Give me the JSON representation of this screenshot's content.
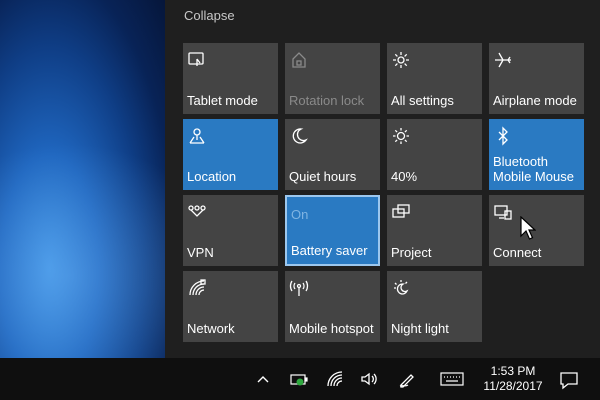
{
  "action_center": {
    "collapse_label": "Collapse",
    "tiles": [
      {
        "label": "Tablet mode",
        "icon": "tablet-mode-icon",
        "state": "off"
      },
      {
        "label": "Rotation lock",
        "icon": "rotation-lock-icon",
        "state": "disabled"
      },
      {
        "label": "All settings",
        "icon": "gear-icon",
        "state": "off"
      },
      {
        "label": "Airplane mode",
        "icon": "airplane-icon",
        "state": "off"
      },
      {
        "label": "Location",
        "icon": "location-icon",
        "state": "on"
      },
      {
        "label": "Quiet hours",
        "icon": "moon-icon",
        "state": "off"
      },
      {
        "label": "40%",
        "icon": "brightness-icon",
        "state": "off"
      },
      {
        "label": "Bluetooth\nMobile Mouse",
        "line1": "Bluetooth",
        "line2": "Mobile Mouse",
        "icon": "bluetooth-icon",
        "state": "on"
      },
      {
        "label": "VPN",
        "icon": "vpn-icon",
        "state": "off"
      },
      {
        "label": "Battery saver",
        "icon": "battery-saver-icon",
        "state": "selected",
        "status_text": "On"
      },
      {
        "label": "Project",
        "icon": "project-icon",
        "state": "off"
      },
      {
        "label": "Connect",
        "icon": "connect-icon",
        "state": "off"
      },
      {
        "label": "Network",
        "icon": "network-icon",
        "state": "off"
      },
      {
        "label": "Mobile hotspot",
        "icon": "hotspot-icon",
        "state": "off"
      },
      {
        "label": "Night light",
        "icon": "night-light-icon",
        "state": "off"
      }
    ]
  },
  "taskbar": {
    "time": "1:53 PM",
    "date": "11/28/2017"
  },
  "colors": {
    "tile": "#444444",
    "tile_on": "#2a7ac2",
    "panel": "#1f1f1f",
    "taskbar": "#0f0f0f"
  }
}
